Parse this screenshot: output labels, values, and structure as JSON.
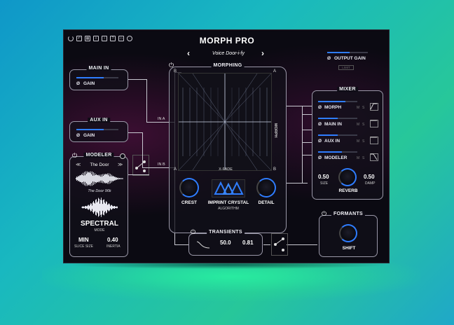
{
  "title": "MORPH PRO",
  "preset": {
    "name": "Voice Door-i-fy",
    "prev": "‹",
    "next": "›"
  },
  "output": {
    "label": "OUTPUT GAIN",
    "limit": "LIMIT",
    "gain": 0.55
  },
  "main_in": {
    "title": "MAIN IN",
    "gain_label": "GAIN",
    "gain": 0.65
  },
  "aux_in": {
    "title": "AUX IN",
    "gain_label": "GAIN",
    "gain": 0.65
  },
  "morphing": {
    "title": "MORPHING",
    "corner_a": "A",
    "corner_b": "B",
    "xfade_label": "X-FADE",
    "morph_label": "MORPH",
    "in_a": "IN A",
    "in_b": "IN B"
  },
  "algorithm": {
    "crest": "CREST",
    "detail": "DETAIL",
    "name": "IMPRINT CRYSTAL",
    "sub": "ALGORITHM"
  },
  "mixer": {
    "title": "MIXER",
    "channels": [
      {
        "label": "MORPH",
        "level": 0.7
      },
      {
        "label": "MAIN IN",
        "level": 0.5
      },
      {
        "label": "AUX IN",
        "level": 0.5
      },
      {
        "label": "MODELER",
        "level": 0.6
      }
    ],
    "m": "M",
    "s": "S",
    "size_value": "0.50",
    "size_label": "SIZE",
    "damp_value": "0.50",
    "damp_label": "DAMP",
    "reverb_label": "REVERB"
  },
  "modeler": {
    "title": "MODELER",
    "source": "The Door",
    "sample": "The Door 96k",
    "mode_value": "SPECTRAL",
    "mode_label": "MODE",
    "slice_value": "MIN",
    "slice_label": "SLICE SIZE",
    "inertia_value": "0.40",
    "inertia_label": "INERTIA"
  },
  "transients": {
    "title": "TRANSIENTS",
    "v1": "50.0",
    "v2": "0.81"
  },
  "formants": {
    "title": "FORMANTS",
    "shift_label": "SHIFT"
  },
  "colors": {
    "accent": "#2f7dff",
    "panel_border": "#9a98a8",
    "bg": "#0b0a12"
  }
}
